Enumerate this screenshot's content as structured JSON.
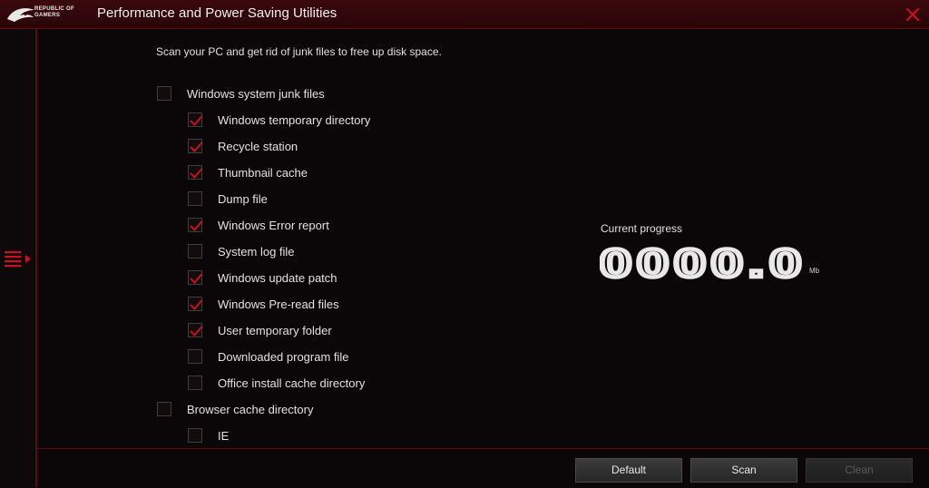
{
  "window": {
    "title": "Performance and Power Saving Utilities",
    "logo_text_line1": "REPUBLIC OF",
    "logo_text_line2": "GAMERS"
  },
  "main": {
    "description": "Scan your PC and get rid of junk files to free up disk space.",
    "groups": [
      {
        "label": "Windows system junk files",
        "checked": false,
        "items": [
          {
            "label": "Windows temporary directory",
            "checked": true
          },
          {
            "label": "Recycle station",
            "checked": true
          },
          {
            "label": "Thumbnail cache",
            "checked": true
          },
          {
            "label": "Dump file",
            "checked": false
          },
          {
            "label": "Windows Error report",
            "checked": true
          },
          {
            "label": "System log file",
            "checked": false
          },
          {
            "label": "Windows update patch",
            "checked": true
          },
          {
            "label": "Windows Pre-read files",
            "checked": true
          },
          {
            "label": "User temporary folder",
            "checked": true
          },
          {
            "label": "Downloaded program file",
            "checked": false
          },
          {
            "label": "Office install cache directory",
            "checked": false
          }
        ]
      },
      {
        "label": "Browser cache directory",
        "checked": false,
        "items": [
          {
            "label": "IE",
            "checked": false
          }
        ]
      }
    ]
  },
  "progress": {
    "label": "Current progress",
    "value": "0000.0",
    "unit": "Mb"
  },
  "footer": {
    "default_label": "Default",
    "scan_label": "Scan",
    "clean_label": "Clean"
  },
  "colors": {
    "accent": "#c8101e",
    "border_red": "#5c0a10",
    "background": "#0b0708"
  },
  "icons": [
    "rog-logo-icon",
    "close-icon",
    "menu-icon",
    "checkmark-icon"
  ]
}
